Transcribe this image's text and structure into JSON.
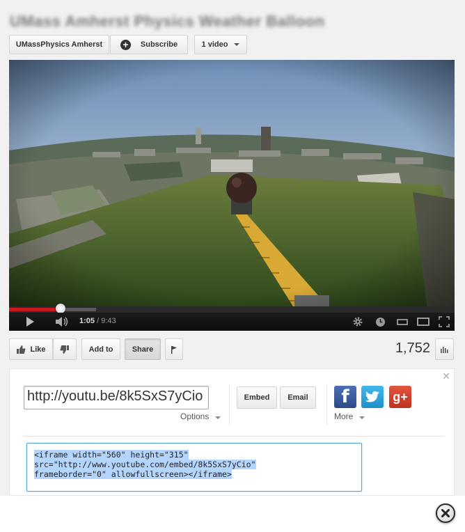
{
  "header": {
    "title": "UMass Amherst Physics Weather Balloon",
    "channel_label": "UMassPhysics Amherst",
    "subscribe_label": "Subscribe",
    "videos_label": "1 video"
  },
  "player": {
    "current_time": "1:05",
    "duration": "/ 9:43",
    "progress": 0.115,
    "buffered": 0.195
  },
  "actions": {
    "like_label": "Like",
    "add_to_label": "Add to",
    "share_label": "Share",
    "view_count": "1,752"
  },
  "share": {
    "short_url": "http://youtu.be/8k5SxS7yCio",
    "options_label": "Options",
    "embed_label": "Embed",
    "email_label": "Email",
    "more_label": "More",
    "embed_code_line1": "<iframe width=\"560\" height=\"315\"",
    "embed_code_line2": "src=\"http://www.youtube.com/embed/8k5SxS7yCio\"",
    "embed_code_line3": "frameborder=\"0\" allowfullscreen></iframe>"
  },
  "colors": {
    "progress_red": "#cc181e",
    "facebook": "#3b5998",
    "twitter": "#2fa6df",
    "google_plus": "#d13c2c"
  }
}
